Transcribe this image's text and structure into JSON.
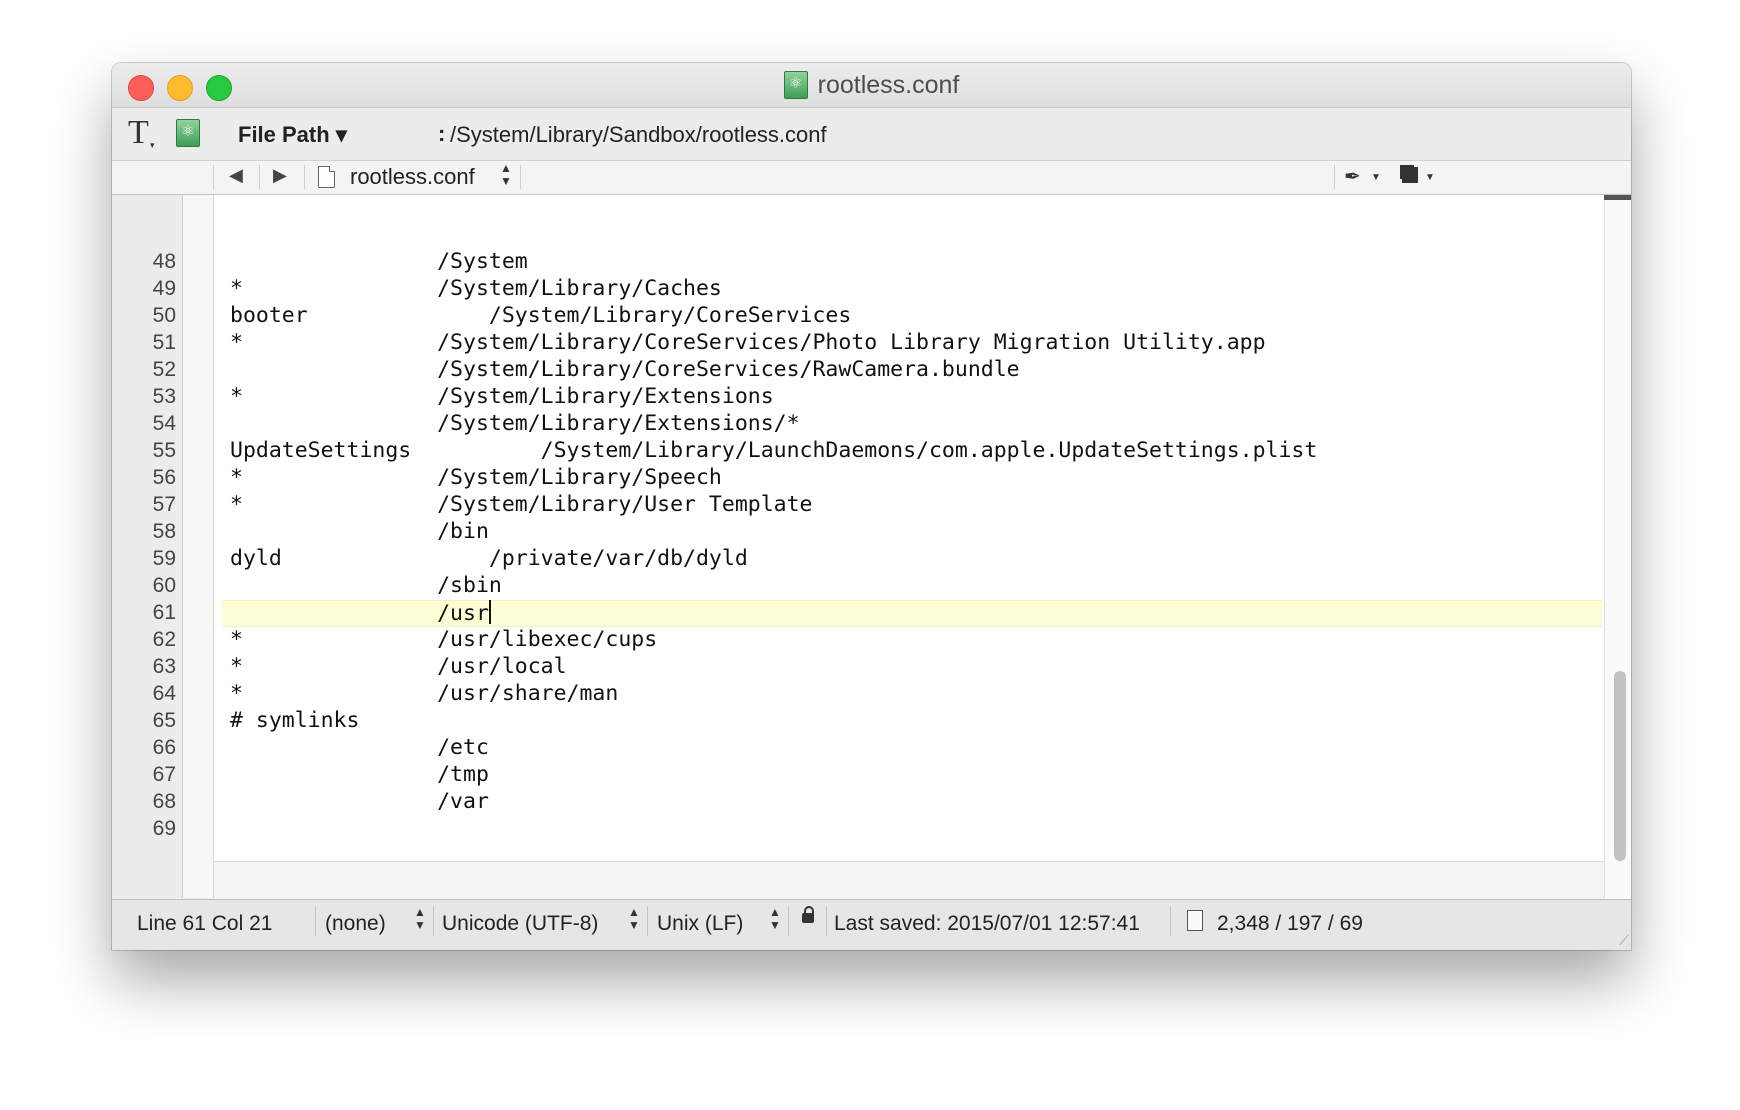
{
  "window": {
    "title": "rootless.conf"
  },
  "pathbar": {
    "label": "File Path",
    "caret": "▾",
    "colon": ":",
    "value": "/System/Library/Sandbox/rootless.conf"
  },
  "navbar": {
    "back": "◀",
    "forward": "▶",
    "filename": "rootless.conf",
    "updown": "▲\n▼"
  },
  "editor": {
    "current_line": 61,
    "lines": [
      {
        "num": "48",
        "text": "                /System"
      },
      {
        "num": "49",
        "text": "*               /System/Library/Caches"
      },
      {
        "num": "50",
        "text": "booter              /System/Library/CoreServices"
      },
      {
        "num": "51",
        "text": "*               /System/Library/CoreServices/Photo Library Migration Utility.app"
      },
      {
        "num": "52",
        "text": "                /System/Library/CoreServices/RawCamera.bundle"
      },
      {
        "num": "53",
        "text": "*               /System/Library/Extensions"
      },
      {
        "num": "54",
        "text": "                /System/Library/Extensions/*"
      },
      {
        "num": "55",
        "text": "UpdateSettings          /System/Library/LaunchDaemons/com.apple.UpdateSettings.plist"
      },
      {
        "num": "56",
        "text": "*               /System/Library/Speech"
      },
      {
        "num": "57",
        "text": "*               /System/Library/User Template"
      },
      {
        "num": "58",
        "text": "                /bin"
      },
      {
        "num": "59",
        "text": "dyld                /private/var/db/dyld"
      },
      {
        "num": "60",
        "text": "                /sbin"
      },
      {
        "num": "61",
        "text": "                /usr"
      },
      {
        "num": "62",
        "text": "*               /usr/libexec/cups"
      },
      {
        "num": "63",
        "text": "*               /usr/local"
      },
      {
        "num": "64",
        "text": "*               /usr/share/man"
      },
      {
        "num": "65",
        "text": "# symlinks"
      },
      {
        "num": "66",
        "text": "                /etc"
      },
      {
        "num": "67",
        "text": "                /tmp"
      },
      {
        "num": "68",
        "text": "                /var"
      },
      {
        "num": "69",
        "text": ""
      }
    ]
  },
  "statusbar": {
    "position": "Line 61 Col 21",
    "language": "(none)",
    "encoding": "Unicode (UTF-8)",
    "line_endings": "Unix (LF)",
    "last_saved": "Last saved: 2015/07/01 12:57:41",
    "counts": "2,348 / 197 / 69"
  },
  "icons": {
    "text_tool": "T",
    "pen": "✒",
    "resize": "⟋"
  }
}
